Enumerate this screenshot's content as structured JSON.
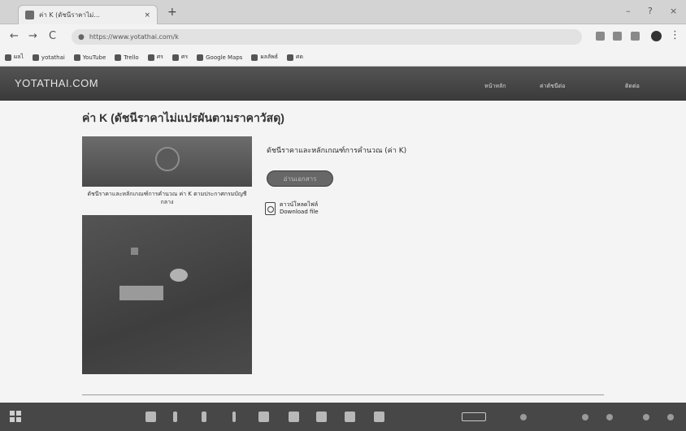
{
  "browser": {
    "tab_title": "ค่า K (ดัชนีราคาไม่...",
    "tab_close": "×",
    "new_tab": "+",
    "win_minimize": "–",
    "win_maximize": "?",
    "win_close": "×",
    "nav_back": "←",
    "nav_forward": "→",
    "nav_reload": "C",
    "url": "https://www.yotathai.com/k",
    "menu_glyph": "⋮"
  },
  "bookmarks": [
    "ผลไ",
    "yotathai",
    "YouTube",
    "Trello",
    "ศร",
    "ศร",
    "Google Maps",
    "ผลลัพธ์",
    "ศด"
  ],
  "site": {
    "logo": "YOTATHAI.COM",
    "nav_links": [
      "หน้าหลัก",
      "ค่าดัชนีต่อ",
      "ติดต่อ"
    ]
  },
  "page": {
    "title": "ค่า K (ดัชนีราคาไม่แปรผันตามราคาวัสดุ)",
    "image_caption": "ดัชนีราคาและหลักเกณฑ์การคำนวณ ค่า K ตามประกาศกรมบัญชีกลาง",
    "doc_heading": "ดัชนีราคาและหลักเกณฑ์การคำนวณ (ค่า K)",
    "read_button": "อ่านเอกสาร",
    "download_line1": "ดาวน์โหลดไฟล์",
    "download_line2": "Download file"
  }
}
